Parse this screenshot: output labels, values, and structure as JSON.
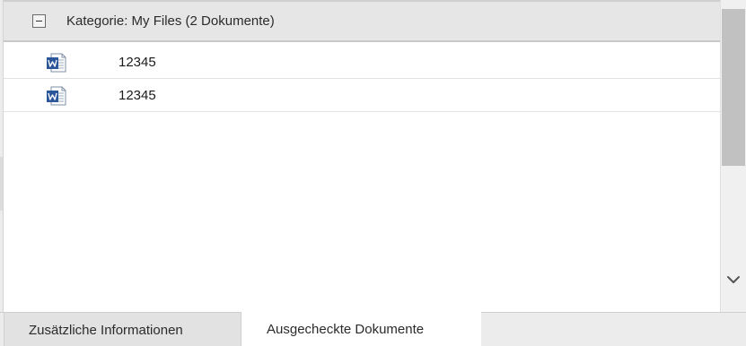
{
  "group": {
    "toggle_state": "expanded",
    "title": "Kategorie: My Files (2 Dokumente)"
  },
  "rows": [
    {
      "icon": "word-document-icon",
      "name": "12345"
    },
    {
      "icon": "word-document-icon",
      "name": "12345"
    }
  ],
  "tabs": [
    {
      "label": "Zusätzliche Informationen",
      "active": false
    },
    {
      "label": "Ausgecheckte Dokumente",
      "active": true
    }
  ],
  "colors": {
    "header_bg": "#e6e6e6",
    "word_blue": "#2b579a",
    "scroll_thumb": "#c1c1c1",
    "active_tab": "#ffffff",
    "inactive_tab": "#e2e2e2"
  }
}
